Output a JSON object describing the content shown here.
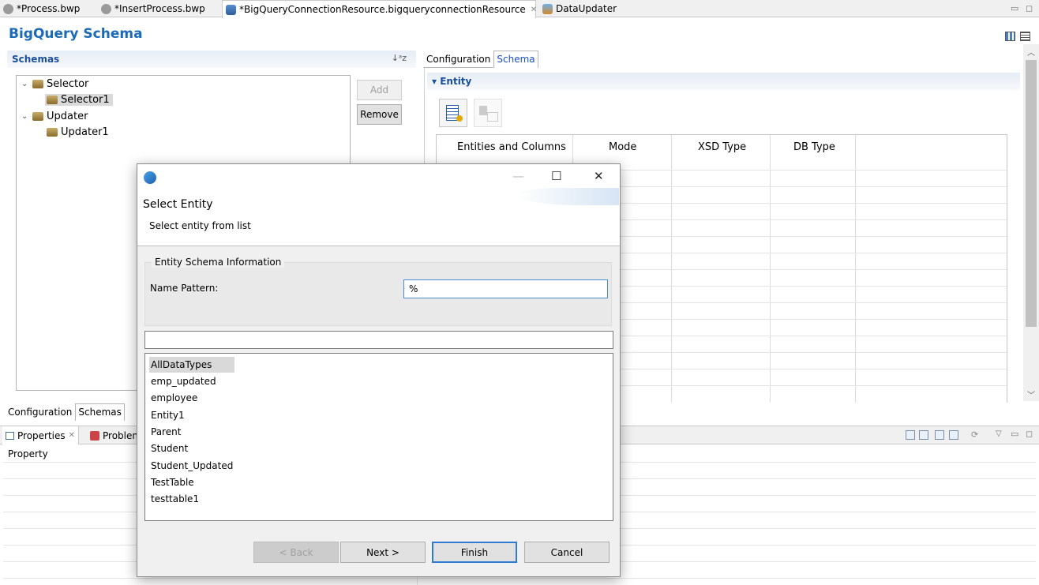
{
  "editor_tabs": [
    {
      "label": "*Process.bwp",
      "icon": "gear-icon"
    },
    {
      "label": "*InsertProcess.bwp",
      "icon": "gear-icon"
    },
    {
      "label": "*BigQueryConnectionResource.bigqueryconnectionResource",
      "icon": "bigquery-resource-icon"
    },
    {
      "label": "DataUpdater",
      "icon": "data-updater-icon"
    }
  ],
  "editor": {
    "title": "BigQuery Schema"
  },
  "schemas": {
    "header": "Schemas",
    "tree": [
      {
        "label": "Selector",
        "children": [
          "Selector1"
        ]
      },
      {
        "label": "Updater",
        "children": [
          "Updater1"
        ]
      }
    ],
    "add_label": "Add",
    "remove_label": "Remove",
    "bottom_tabs": [
      "Configuration",
      "Schemas"
    ]
  },
  "right": {
    "tabs": [
      "Configuration",
      "Schema"
    ],
    "section": "Entity",
    "columns": [
      "Entities and Columns",
      "Mode",
      "XSD Type",
      "DB Type"
    ]
  },
  "properties": {
    "tabs": [
      "Properties",
      "Problen"
    ],
    "column": "Property"
  },
  "dialog": {
    "title": "Select Entity",
    "subtitle": "Select entity from list",
    "group_label": "Entity Schema Information",
    "name_pattern_label": "Name Pattern:",
    "name_pattern_value": "%",
    "filter_value": "",
    "entities": [
      "AllDataTypes",
      "emp_updated",
      "employee",
      "Entity1",
      "Parent",
      "Student",
      "Student_Updated",
      "TestTable",
      "testtable1"
    ],
    "selected_entity": "AllDataTypes",
    "buttons": {
      "back": "< Back",
      "next": "Next >",
      "finish": "Finish",
      "cancel": "Cancel"
    }
  },
  "colors": {
    "accent": "#1a6ab8",
    "section_header": "#1a4f9c",
    "default_button_border": "#2f7bd2"
  }
}
